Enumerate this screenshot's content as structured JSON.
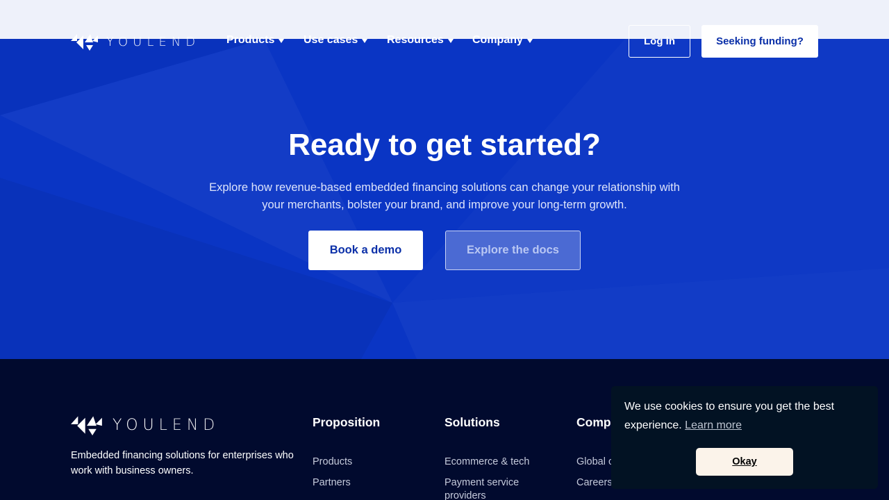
{
  "brand": {
    "logo_part1": "YOU",
    "logo_part2": "LEND"
  },
  "nav": {
    "items": [
      {
        "label": "Products"
      },
      {
        "label": "Use cases"
      },
      {
        "label": "Resources"
      },
      {
        "label": "Company"
      }
    ],
    "login_label": "Log in",
    "funding_label": "Seeking funding?"
  },
  "hero": {
    "title": "Ready to get started?",
    "subtitle": "Explore how revenue-based embedded financing solutions can change your relationship with your merchants, bolster your brand, and improve your long-term growth.",
    "demo_label": "Book a demo",
    "docs_label": "Explore the docs"
  },
  "footer": {
    "tagline": "Embedded financing solutions for enterprises who work with business owners.",
    "columns": [
      {
        "title": "Proposition",
        "links": [
          "Products",
          "Partners"
        ]
      },
      {
        "title": "Solutions",
        "links": [
          "Ecommerce & tech",
          "Payment service providers"
        ]
      },
      {
        "title": "Comp",
        "links": [
          "Global c",
          "Careers"
        ]
      }
    ]
  },
  "cookie": {
    "message": "We use cookies to ensure you get the best experience.",
    "learn_more": "Learn more",
    "okay_label": "Okay"
  },
  "colors": {
    "hero_bg": "#0a35c4",
    "footer_bg": "#010a2e",
    "accent_text": "#0a2fa8",
    "cookie_bg": "#021223",
    "okay_bg": "#fbf3ea"
  },
  "icons": {
    "logo": "youlend-logo-icon",
    "dropdown": "caret-down-icon"
  }
}
